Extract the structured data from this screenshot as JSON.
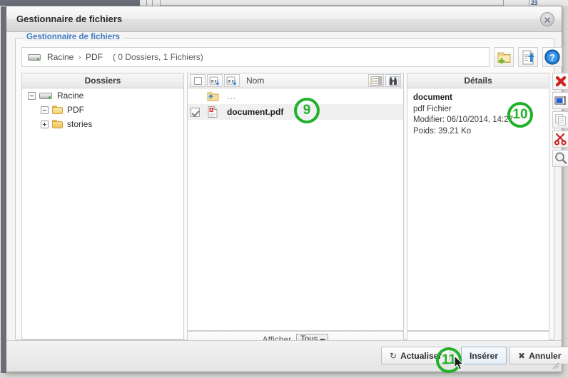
{
  "background": {
    "corner_number": "23"
  },
  "dialog": {
    "title": "Gestionnaire de fichiers",
    "close_icon": "close-icon",
    "legend": "Gestionnaire de fichiers"
  },
  "breadcrumb": {
    "drive_icon": "drive-icon",
    "root": "Racine",
    "separator": "›",
    "current": "PDF",
    "count": "( 0 Dossiers, 1 Fichiers)"
  },
  "toolbar": [
    {
      "name": "new-folder-button",
      "icon": "new-folder-icon"
    },
    {
      "name": "upload-file-button",
      "icon": "upload-file-icon"
    },
    {
      "name": "help-button",
      "icon": "help-icon"
    }
  ],
  "folders_panel": {
    "header": "Dossiers",
    "tree": [
      {
        "label": "Racine",
        "icon": "drive-icon",
        "toggle": "minus",
        "indent": 0
      },
      {
        "label": "PDF",
        "icon": "folder-open-icon",
        "toggle": "minus",
        "indent": 1
      },
      {
        "label": "stories",
        "icon": "folder-icon",
        "toggle": "plus",
        "indent": 1
      }
    ]
  },
  "files_panel": {
    "header": {
      "select_all_checkbox": false,
      "sort_asc_icon": "sort-az-icon",
      "sort_desc_icon": "sort-az-icon",
      "name_label": "Nom",
      "list_view_icon": "list-view-icon",
      "preview_view_icon": "binoculars-icon"
    },
    "rows": [
      {
        "name": "...",
        "icon": "parent-folder-icon",
        "checked": null,
        "selected": false
      },
      {
        "name": "document.pdf",
        "icon": "pdf-file-icon",
        "checked": true,
        "selected": true
      }
    ],
    "footer": {
      "label": "Afficher",
      "selected_option": "Tous",
      "options": [
        "Tous"
      ]
    }
  },
  "details_panel": {
    "header": "Détails",
    "title": "document",
    "type": "pdf Fichier",
    "modified": "Modifier: 06/10/2014, 14:27",
    "size": "Poids: 39.21 Ko"
  },
  "actions": [
    {
      "name": "delete-button",
      "icon": "red-x-icon",
      "enabled": true
    },
    {
      "name": "rename-button",
      "icon": "rename-icon",
      "enabled": true
    },
    {
      "name": "copy-button",
      "icon": "copy-icon",
      "enabled": false
    },
    {
      "name": "cut-button",
      "icon": "scissors-icon",
      "enabled": true
    },
    {
      "name": "preview-button",
      "icon": "magnifier-icon",
      "enabled": true
    }
  ],
  "footer_buttons": [
    {
      "name": "refresh-button",
      "label": "Actualiser",
      "icon": "refresh-icon"
    },
    {
      "name": "insert-button",
      "label": "Insérer",
      "icon": ""
    },
    {
      "name": "cancel-button",
      "label": "Annuler",
      "icon": "x-icon"
    }
  ],
  "annotations": [
    {
      "id": "9",
      "label": "9"
    },
    {
      "id": "10",
      "label": "10"
    },
    {
      "id": "11",
      "label": "11"
    }
  ],
  "colors": {
    "annotation_green": "#22b12a",
    "legend_blue": "#3f7bbf",
    "window_chrome": "#6b6e78"
  }
}
